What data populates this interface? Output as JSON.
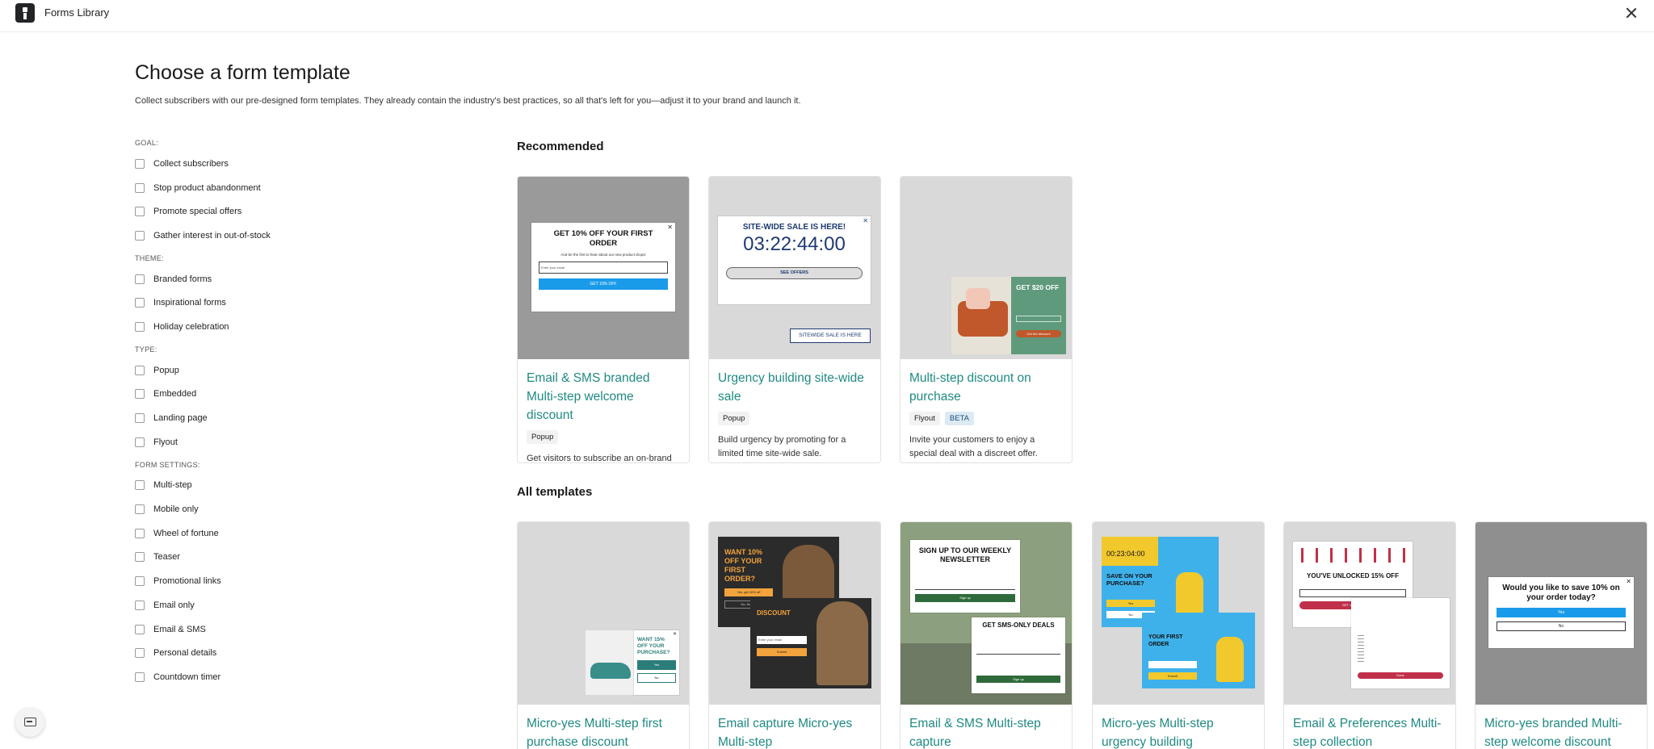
{
  "app": {
    "title": "Forms Library"
  },
  "header": {
    "title": "Choose a form template",
    "description": "Collect subscribers with our pre-designed form templates. They already contain the industry's best practices, so all that's left for you—adjust it to your brand and launch it."
  },
  "filters": [
    {
      "label": "GOAL:",
      "items": [
        "Collect subscribers",
        "Stop product abandonment",
        "Promote special offers",
        "Gather interest in out-of-stock"
      ]
    },
    {
      "label": "THEME:",
      "items": [
        "Branded forms",
        "Inspirational forms",
        "Holiday celebration"
      ]
    },
    {
      "label": "TYPE:",
      "items": [
        "Popup",
        "Embedded",
        "Landing page",
        "Flyout"
      ]
    },
    {
      "label": "FORM SETTINGS:",
      "items": [
        "Multi-step",
        "Mobile only",
        "Wheel of fortune",
        "Teaser",
        "Promotional links",
        "Email only",
        "Email & SMS",
        "Personal details",
        "Countdown timer"
      ]
    }
  ],
  "recommended": {
    "title": "Recommended",
    "cards": [
      {
        "title": "Email & SMS branded Multi-step welcome discount",
        "tags": [
          "Popup"
        ],
        "desc": "Get visitors to subscribe an on-brand form Multi-step form.",
        "mock": {
          "heading": "GET 10% OFF YOUR FIRST ORDER",
          "sub": "And be the first to hear about our new product drops!",
          "input": "Enter your email",
          "button": "GET 10% OFF"
        }
      },
      {
        "title": "Urgency building site-wide sale",
        "tags": [
          "Popup"
        ],
        "desc": "Build urgency by promoting for a limited time site-wide sale.",
        "mock": {
          "heading": "SITE-WIDE SALE IS HERE!",
          "timer": "03:22:44:00",
          "button": "SEE OFFERS",
          "teaser": "SITEWIDE SALE IS HERE"
        }
      },
      {
        "title": "Multi-step discount on purchase",
        "tags": [
          "Flyout",
          "BETA"
        ],
        "desc": "Invite your customers to enjoy a special deal with a discreet offer.",
        "mock": {
          "heading": "GET $20 OFF",
          "button": "Get the discount"
        }
      }
    ]
  },
  "all_templates": {
    "title": "All templates",
    "cards": [
      {
        "title": "Micro-yes Multi-step first purchase discount",
        "mock": {
          "heading": "WANT 15% OFF YOUR PURCHASE?",
          "yes": "Yes",
          "no": "No"
        }
      },
      {
        "title": "Email capture Micro-yes Multi-step",
        "mock": {
          "heading": "WANT 10% OFF YOUR FIRST ORDER?",
          "yes": "Yes, get 10% off",
          "no": "No, thanks",
          "heading2": "DISCOUNT",
          "input": "Enter your email",
          "button": "Submit"
        }
      },
      {
        "title": "Email & SMS Multi-step capture",
        "mock": {
          "heading": "SIGN UP TO OUR WEEKLY NEWSLETTER",
          "button": "Sign up",
          "heading2": "GET SMS-ONLY DEALS",
          "button2": "Sign up"
        }
      },
      {
        "title": "Micro-yes Multi-step urgency building",
        "mock": {
          "timer": "00:23:04:00",
          "heading": "SAVE ON YOUR PURCHASE?",
          "yes": "Yes",
          "no": "No",
          "heading2": "YOUR FIRST ORDER",
          "button": "Submit"
        }
      },
      {
        "title": "Email & Preferences Multi-step collection",
        "mock": {
          "heading": "YOU'VE UNLOCKED 15% OFF",
          "button": "GET 15% OFF",
          "button2": "Done"
        }
      },
      {
        "title": "Micro-yes branded Multi-step welcome discount",
        "mock": {
          "heading": "Would you like to save 10% on your order today?",
          "yes": "Yes",
          "no": "No"
        }
      }
    ]
  },
  "colors": {
    "accent": "#1f8a82",
    "primary_button": "#1a9bea",
    "thumb_bg": "#d9d9d9"
  },
  "icons": {
    "logo": "brand-logo-icon",
    "close": "close-icon",
    "chat": "chat-icon"
  }
}
